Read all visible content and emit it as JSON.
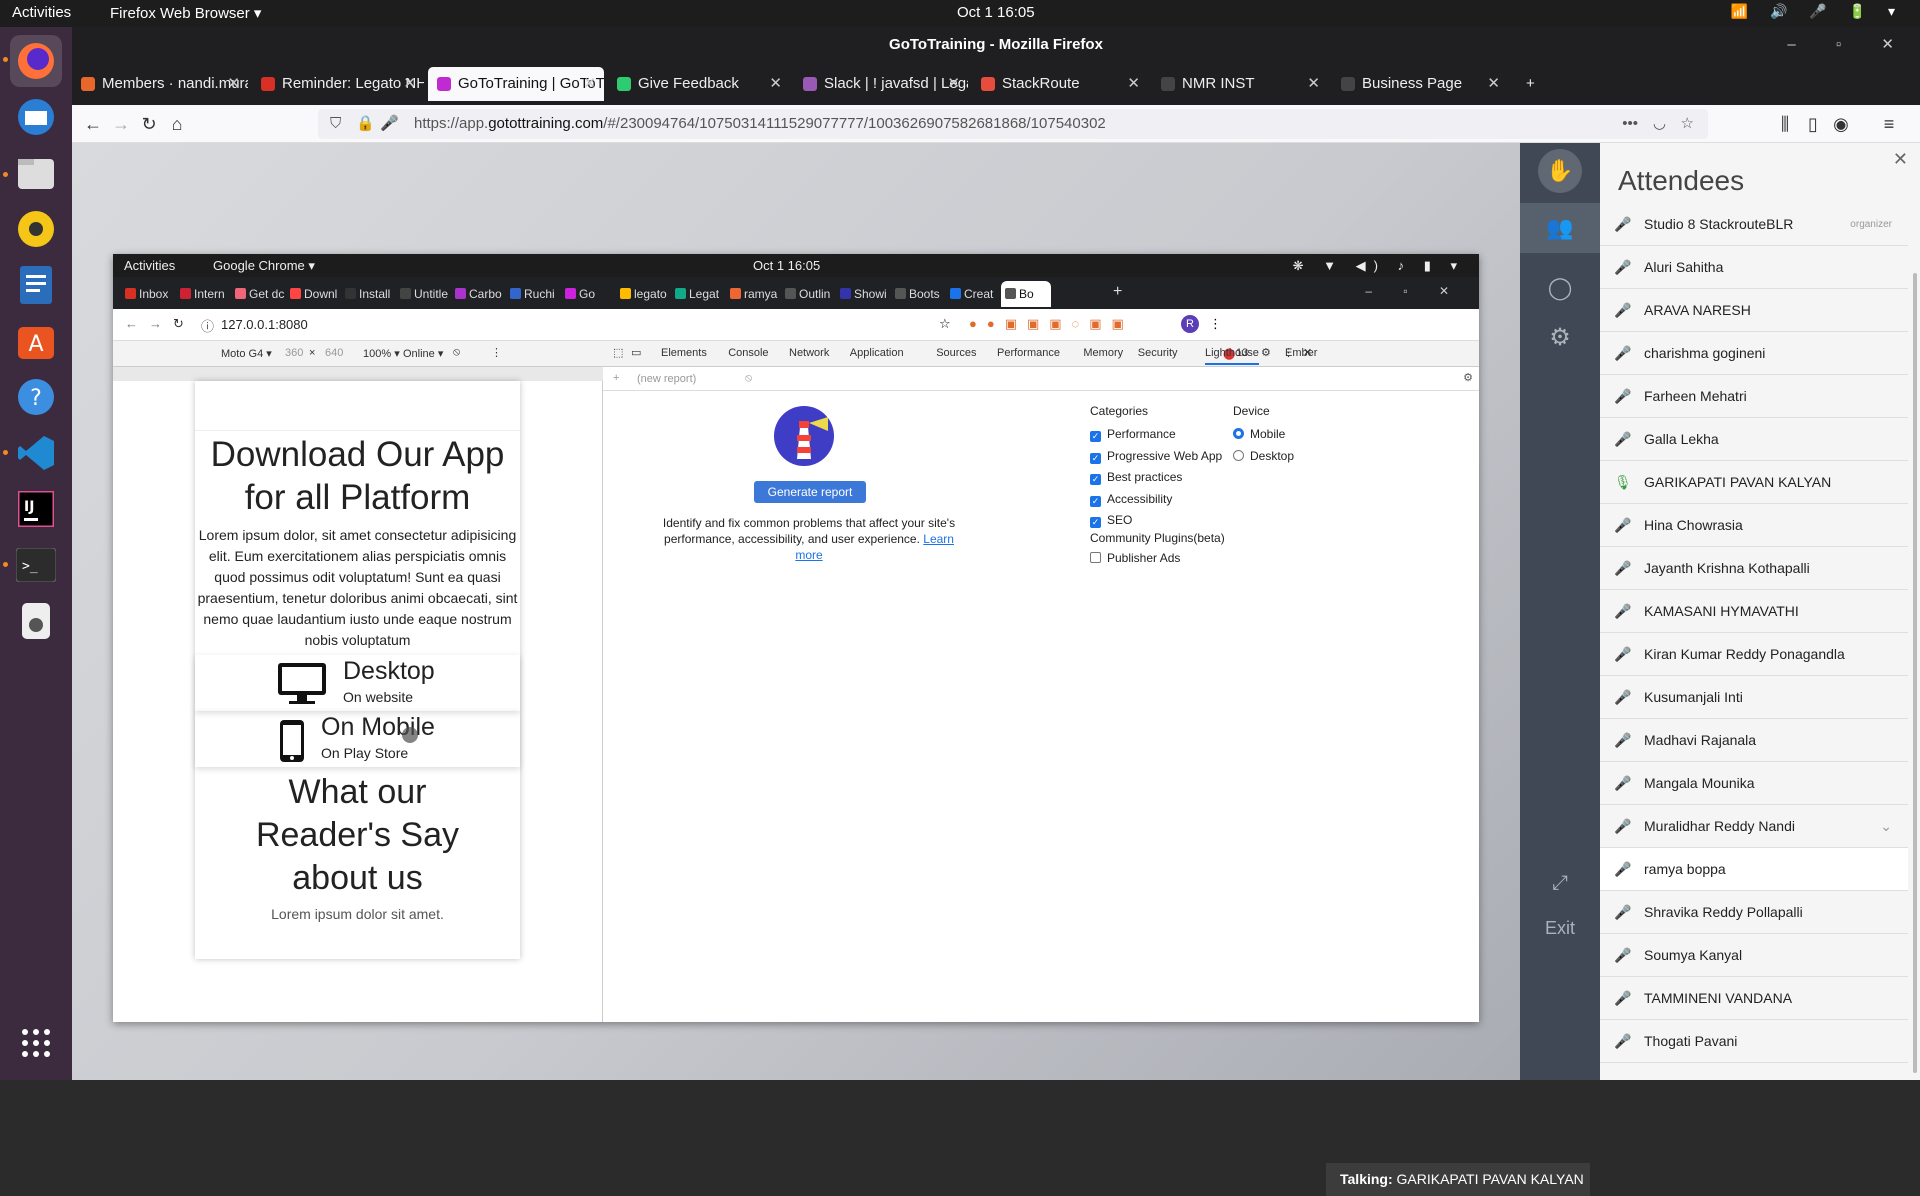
{
  "system": {
    "activities": "Activities",
    "app_menu": "Firefox Web Browser ▾",
    "clock": "Oct 1  16:05",
    "tray": "📶 🔊 🎤 🔋 ▾"
  },
  "dock": {
    "items": [
      "firefox-icon",
      "thunderbird-icon",
      "files-icon",
      "rhythmbox-icon",
      "libreoffice-writer-icon",
      "software-center-icon",
      "help-icon",
      "vscode-icon",
      "intellij-icon",
      "terminal-icon",
      "disk-icon"
    ],
    "apps_grid": "⋮⋮⋮"
  },
  "firefox": {
    "title": "GoToTraining - Mozilla Firefox",
    "window_controls": "– ▫ ✕",
    "tabs": [
      {
        "label": "Members · nandi.muralid",
        "color": "#e8682c"
      },
      {
        "label": "Reminder: Legato NHT W",
        "color": "#d93025"
      },
      {
        "label": "GoToTraining | GoToTr",
        "color": "#c22ad1"
      },
      {
        "label": "Give Feedback",
        "color": "#2ecc71"
      },
      {
        "label": "Slack | ! javafsd | Legato",
        "color": "#9b59b6"
      },
      {
        "label": "StackRoute",
        "color": "#e74c3c"
      },
      {
        "label": "NMR INST",
        "color": "#444"
      },
      {
        "label": "Business Page",
        "color": "#444"
      }
    ],
    "new_tab": "+",
    "url_prefix": "https://app.",
    "url_domain": "gotottraining.com",
    "url_rest": "/#/230094764/10750314111529077777/1003626907582681868/107540302"
  },
  "shared": {
    "top": {
      "activities": "Activities",
      "app": "Google Chrome ▾",
      "clock": "Oct 1  16:05"
    },
    "chrome_tabs": [
      "Inbox",
      "Intern",
      "Get dc",
      "Downl",
      "Install",
      "Untitle",
      "Carbo",
      "Ruchi",
      "Go",
      "legato",
      "Legat",
      "ramya",
      "Outlin",
      "Showi",
      "Boots",
      "Creat",
      "Bo"
    ],
    "url": "127.0.0.1:8080",
    "device_toolbar": {
      "device": "Moto G4 ▾",
      "width": "360",
      "x": "×",
      "height": "640",
      "zoom": "100% ▾",
      "network": "Online ▾"
    },
    "mobile": {
      "heading": "Download Our App for all Platform",
      "body": "Lorem ipsum dolor, sit amet consectetur adipisicing elit. Eum exercitationem alias perspiciatis omnis quod possimus odit voluptatum! Sunt ea quasi praesentium, tenetur doloribus animi obcaecati, sint nemo quae laudantium iusto unde eaque nostrum nobis voluptatum",
      "desktop_title": "Desktop",
      "desktop_sub": "On website",
      "mobile_title": "On Mobile",
      "mobile_sub": "On Play Store",
      "readers": "What our Reader's Say about us",
      "readers_sub": "Lorem ipsum dolor sit amet."
    },
    "devtools_tabs": [
      "Elements",
      "Console",
      "Network",
      "Application",
      "Sources",
      "Performance",
      "Memory",
      "Security",
      "Lighthouse",
      "Ember"
    ],
    "error_count": "13",
    "new_report": "(new report)",
    "lighthouse": {
      "generate": "Generate report",
      "desc": "Identify and fix common problems that affect your site's performance, accessibility, and user experience.",
      "learn": "Learn more",
      "categories_title": "Categories",
      "categories": [
        "Performance",
        "Progressive Web App",
        "Best practices",
        "Accessibility",
        "SEO"
      ],
      "device_title": "Device",
      "devices": [
        "Mobile",
        "Desktop"
      ],
      "plugins_title": "Community Plugins(beta)",
      "plugins": [
        "Publisher Ads"
      ]
    }
  },
  "goto": {
    "attendees_title": "Attendees",
    "organizer": "organizer",
    "attendees": [
      "Studio 8 StackrouteBLR",
      "Aluri Sahitha",
      "ARAVA NARESH",
      "charishma gogineni",
      "Farheen Mehatri",
      "Galla Lekha",
      "GARIKAPATI PAVAN KALYAN",
      "Hina Chowrasia",
      "Jayanth Krishna Kothapalli",
      "KAMASANI HYMAVATHI",
      "Kiran Kumar Reddy Ponagandla",
      "Kusumanjali Inti",
      "Madhavi Rajanala",
      "Mangala Mounika",
      "Muralidhar Reddy Nandi",
      "ramya boppa",
      "Shravika Reddy Pollapalli",
      "Soumya Kanyal",
      "TAMMINENI VANDANA",
      "Thogati Pavani"
    ],
    "talking_label": "Talking:",
    "talking_name": "GARIKAPATI PAVAN KALYAN",
    "exit": "Exit"
  }
}
